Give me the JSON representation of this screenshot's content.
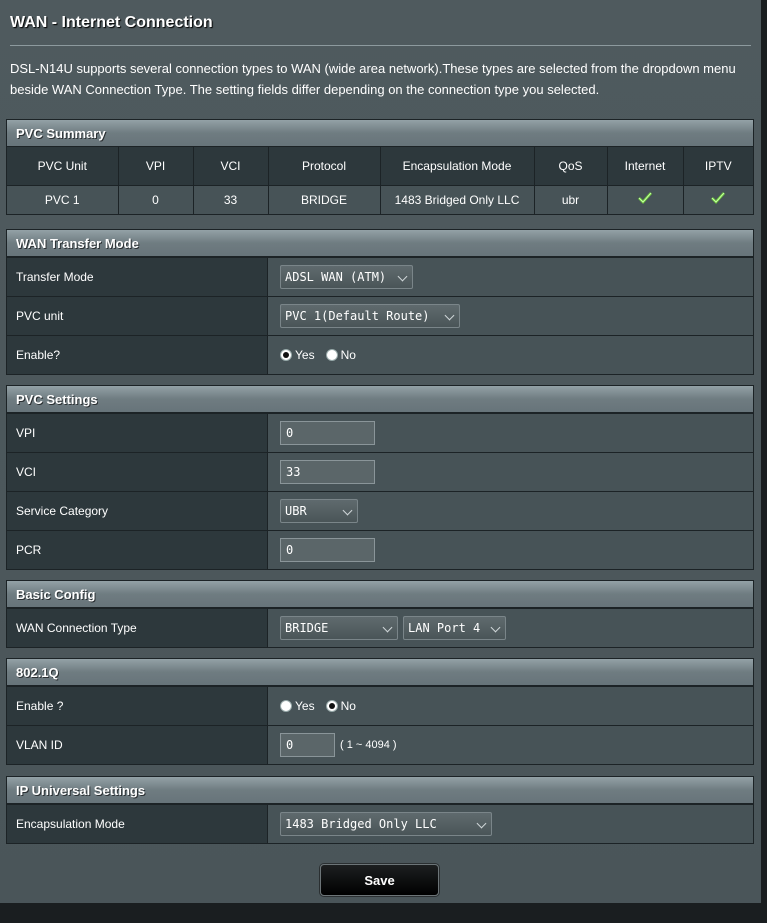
{
  "page_title": "WAN - Internet Connection",
  "description": "DSL-N14U supports several connection types to WAN (wide area network).These types are selected from the dropdown menu beside WAN Connection Type. The setting fields differ depending on the connection type you selected.",
  "pvc_summary": {
    "title": "PVC Summary",
    "columns": [
      "PVC Unit",
      "VPI",
      "VCI",
      "Protocol",
      "Encapsulation Mode",
      "QoS",
      "Internet",
      "IPTV"
    ],
    "rows": [
      {
        "unit": "PVC 1",
        "vpi": "0",
        "vci": "33",
        "protocol": "BRIDGE",
        "encap": "1483 Bridged Only LLC",
        "qos": "ubr",
        "internet": "check-icon",
        "iptv": "check-icon"
      }
    ]
  },
  "wan_transfer": {
    "title": "WAN Transfer Mode",
    "transfer_mode_label": "Transfer Mode",
    "transfer_mode_value": "ADSL WAN (ATM)",
    "pvc_unit_label": "PVC unit",
    "pvc_unit_value": "PVC 1(Default Route)",
    "enable_label": "Enable?",
    "yes_label": "Yes",
    "no_label": "No",
    "enable_selected": "Yes"
  },
  "pvc_settings": {
    "title": "PVC Settings",
    "vpi_label": "VPI",
    "vpi_value": "0",
    "vci_label": "VCI",
    "vci_value": "33",
    "service_label": "Service Category",
    "service_value": "UBR",
    "pcr_label": "PCR",
    "pcr_value": "0"
  },
  "basic_config": {
    "title": "Basic Config",
    "wan_type_label": "WAN Connection Type",
    "wan_type_value": "BRIDGE",
    "lan_port_value": "LAN Port 4"
  },
  "dot1q": {
    "title": "802.1Q",
    "enable_label": "Enable ?",
    "yes_label": "Yes",
    "no_label": "No",
    "enable_selected": "No",
    "vlan_label": "VLAN ID",
    "vlan_value": "0",
    "vlan_range": "( 1 ~ 4094 )"
  },
  "ip_universal": {
    "title": "IP Universal Settings",
    "encap_label": "Encapsulation Mode",
    "encap_value": "1483 Bridged Only LLC"
  },
  "save_label": "Save",
  "colors": {
    "accent_check": "#6fcf3a",
    "section_header": "#7f8d92",
    "label_bg": "#2d383c",
    "value_bg": "#475357"
  }
}
